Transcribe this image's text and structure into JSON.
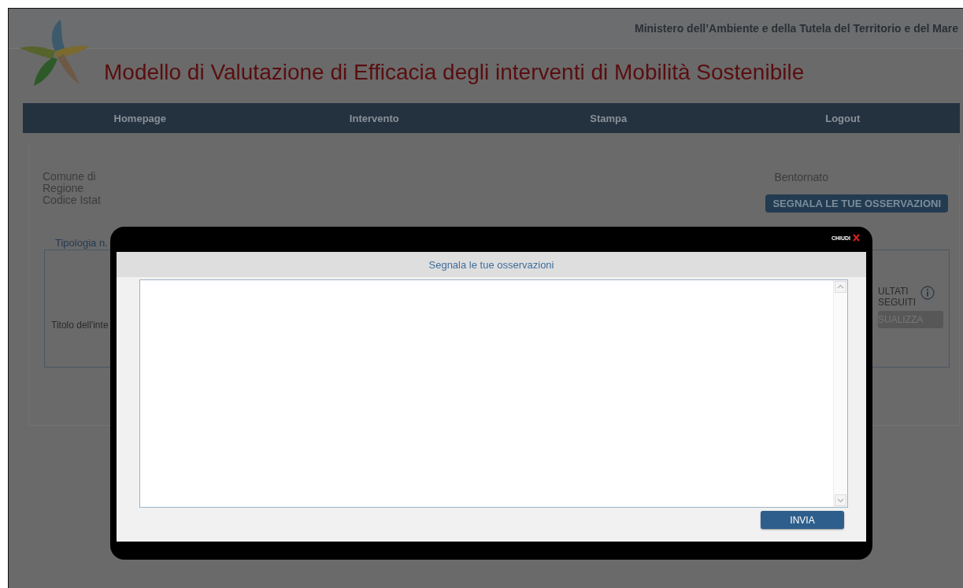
{
  "header": {
    "ministry": "Ministero dell’Ambiente e della Tutela del Territorio e del Mare",
    "title": "Modello di Valutazione di Efficacia degli interventi di Mobilità Sostenibile"
  },
  "nav": [
    {
      "label": "Homepage"
    },
    {
      "label": "Intervento"
    },
    {
      "label": "Stampa"
    },
    {
      "label": "Logout"
    }
  ],
  "info": {
    "lines": [
      "Comune di",
      "Regione",
      "Codice Istat"
    ],
    "greeting": "Bentornato",
    "feedback_button": "SEGNALA LE TUE OSSERVAZIONI"
  },
  "section": {
    "legend": "Tipologia n.",
    "title_label": "Titolo dell'inte",
    "results_label": [
      "ULTATI",
      "SEGUITI"
    ],
    "view_button": "SUALIZZA"
  },
  "modal": {
    "close_label": "CHIUDI",
    "title": "Segnala le tue osservazioni",
    "submit_button": "INVIA"
  }
}
